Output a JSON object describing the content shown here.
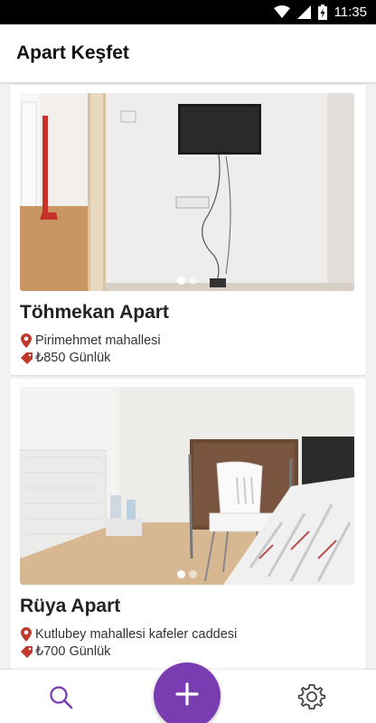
{
  "status_bar": {
    "time": "11:35",
    "icons": [
      "wifi-icon",
      "signal-icon",
      "battery-icon"
    ]
  },
  "app_bar": {
    "title": "Apart Keşfet"
  },
  "listings": [
    {
      "name": "Töhmekan Apart",
      "location": "Pirimehmet mahallesi",
      "price": "₺850 Günlük",
      "photo_count": 2,
      "active_photo": 1
    },
    {
      "name": "Rüya Apart",
      "location": "Kutlubey mahallesi kafeler caddesi",
      "price": "₺700 Günlük",
      "photo_count": 2,
      "active_photo": 1
    }
  ],
  "bottom_nav": {
    "items": [
      "search-icon",
      "add-icon",
      "settings-icon"
    ]
  },
  "colors": {
    "accent": "#7a3db1",
    "location_icon": "#c0392b",
    "price_icon": "#c0392b"
  }
}
